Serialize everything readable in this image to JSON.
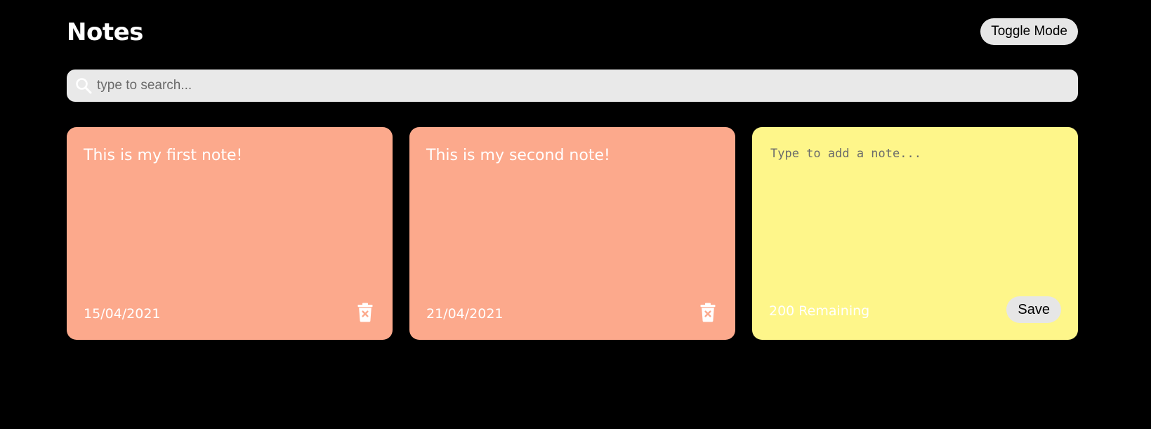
{
  "header": {
    "title": "Notes",
    "toggle_label": "Toggle Mode"
  },
  "search": {
    "placeholder": "type to search...",
    "value": "",
    "icon": "search-icon"
  },
  "notes": [
    {
      "text": "This is my first note!",
      "date": "15/04/2021",
      "icon": "delete-icon"
    },
    {
      "text": "This is my second note!",
      "date": "21/04/2021",
      "icon": "delete-icon"
    }
  ],
  "add_note": {
    "placeholder": "Type to add a note...",
    "value": "",
    "remaining": "200 Remaining",
    "save_label": "Save"
  },
  "colors": {
    "background": "#000000",
    "note": "#fca98c",
    "new_note": "#fef68a",
    "button": "#e6e6e6",
    "search": "#e9e9e9"
  }
}
